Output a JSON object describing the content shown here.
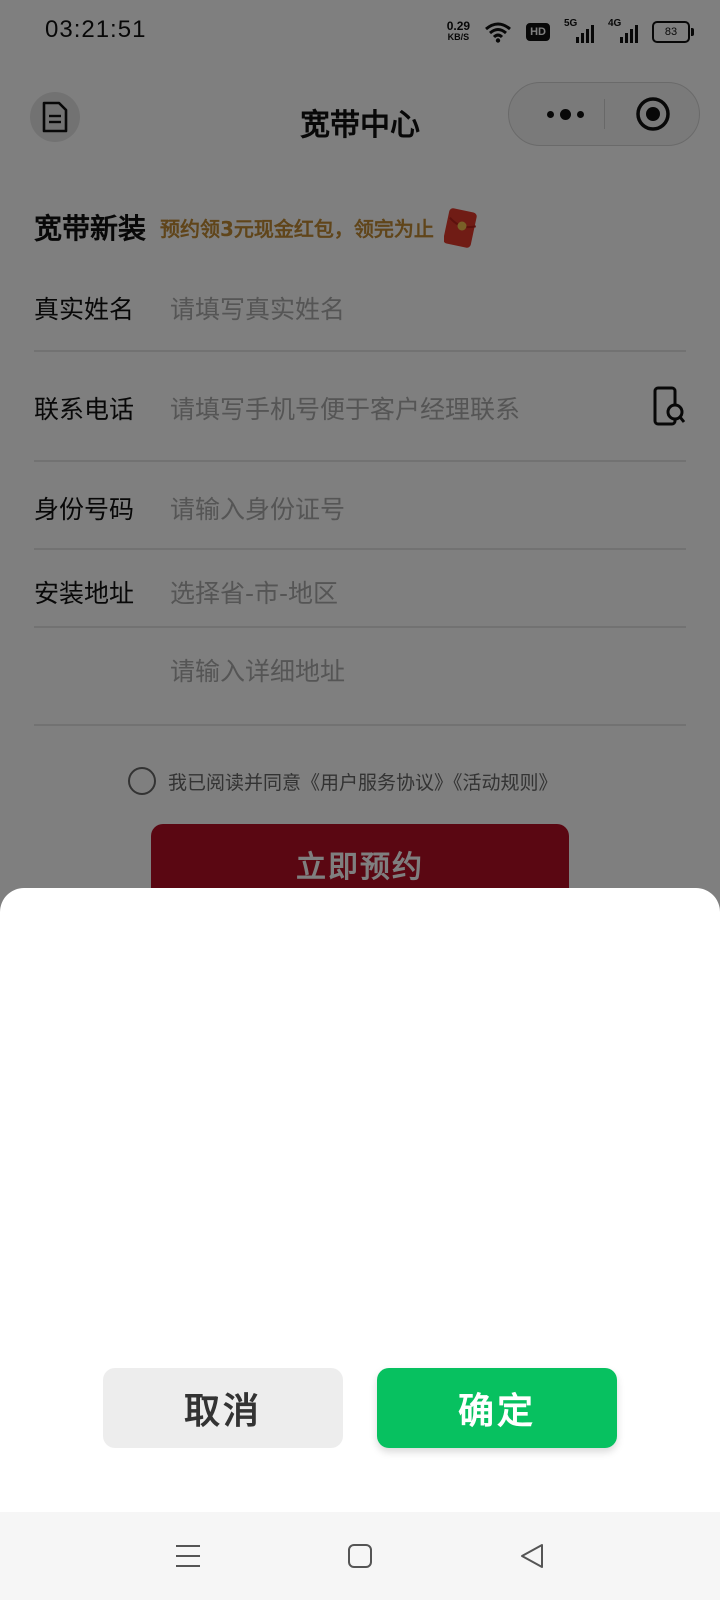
{
  "status_bar": {
    "time": "03:21:51",
    "net_speed": "0.29",
    "net_unit": "KB/S",
    "hd": "HD",
    "sig1": "5G",
    "sig2": "4G",
    "battery": "83"
  },
  "nav": {
    "title": "宽带中心",
    "icons": [
      "document-icon",
      "more-dots-icon",
      "close-target-icon"
    ]
  },
  "form": {
    "headline": "宽带新装",
    "promo": "预约领3元现金红包，领完为止",
    "fields": [
      {
        "label": "真实姓名",
        "placeholder": "请填写真实姓名"
      },
      {
        "label": "联系电话",
        "placeholder": "请填写手机号便于客户经理联系"
      },
      {
        "label": "身份号码",
        "placeholder": "请输入身份证号"
      },
      {
        "label": "安装地址",
        "placeholder": "选择省-市-地区"
      },
      {
        "label": "",
        "placeholder": "请输入详细地址"
      }
    ],
    "agreement": "我已阅读并同意《用户服务协议》《活动规则》",
    "submit": "立即预约"
  },
  "sheet": {
    "cancel": "取消",
    "confirm": "确定"
  },
  "colors": {
    "brand_red": "#b50f25",
    "promo": "#c08a34",
    "confirm_green": "#07c160"
  }
}
